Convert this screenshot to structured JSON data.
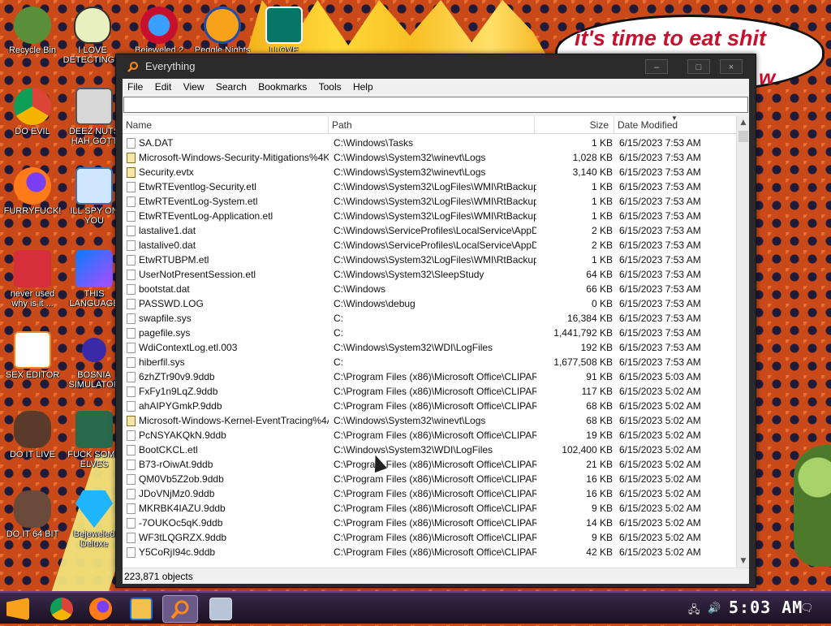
{
  "desktop": {
    "speech": {
      "line1": "it's time to eat shit",
      "line2": "w"
    },
    "icons": [
      {
        "label": "Recycle Bin"
      },
      {
        "label": "I LOVE DETECTING..."
      },
      {
        "label": "Bejeweled 2"
      },
      {
        "label": "Peggle Nights"
      },
      {
        "label": "I LOVE"
      },
      {
        "label": "DO EVIL"
      },
      {
        "label": "DEEZ NUTS HAH GOTT"
      },
      {
        "label": "FURRYFUCK!"
      },
      {
        "label": "ILL SPY ON YOU"
      },
      {
        "label": "never used why is it ..."
      },
      {
        "label": "THIS LANGUAGE"
      },
      {
        "label": "SEX EDITOR"
      },
      {
        "label": "BOSNIA SIMULATOR"
      },
      {
        "label": "DO IT LIVE"
      },
      {
        "label": "FUCK SOME ELVES"
      },
      {
        "label": "DO IT 64 BIT"
      },
      {
        "label": "Bejeweled Deluxe"
      }
    ]
  },
  "window": {
    "title": "Everything",
    "controls": {
      "minimize": "–",
      "maximize": "□",
      "close": "×"
    },
    "menu": [
      "File",
      "Edit",
      "View",
      "Search",
      "Bookmarks",
      "Tools",
      "Help"
    ],
    "search": {
      "value": "",
      "placeholder": ""
    },
    "columns": {
      "name": "Name",
      "path": "Path",
      "size": "Size",
      "date": "Date Modified"
    },
    "rows": [
      {
        "name": "SA.DAT",
        "path": "C:\\Windows\\Tasks",
        "size": "1 KB",
        "date": "6/15/2023 7:53 AM",
        "icon": "file"
      },
      {
        "name": "Microsoft-Windows-Security-Mitigations%4Kern...",
        "path": "C:\\Windows\\System32\\winevt\\Logs",
        "size": "1,028 KB",
        "date": "6/15/2023 7:53 AM",
        "icon": "event-log"
      },
      {
        "name": "Security.evtx",
        "path": "C:\\Windows\\System32\\winevt\\Logs",
        "size": "3,140 KB",
        "date": "6/15/2023 7:53 AM",
        "icon": "event-log"
      },
      {
        "name": "EtwRTEventlog-Security.etl",
        "path": "C:\\Windows\\System32\\LogFiles\\WMI\\RtBackup",
        "size": "1 KB",
        "date": "6/15/2023 7:53 AM",
        "icon": "file"
      },
      {
        "name": "EtwRTEventLog-System.etl",
        "path": "C:\\Windows\\System32\\LogFiles\\WMI\\RtBackup",
        "size": "1 KB",
        "date": "6/15/2023 7:53 AM",
        "icon": "file"
      },
      {
        "name": "EtwRTEventLog-Application.etl",
        "path": "C:\\Windows\\System32\\LogFiles\\WMI\\RtBackup",
        "size": "1 KB",
        "date": "6/15/2023 7:53 AM",
        "icon": "file"
      },
      {
        "name": "lastalive1.dat",
        "path": "C:\\Windows\\ServiceProfiles\\LocalService\\AppDat...",
        "size": "2 KB",
        "date": "6/15/2023 7:53 AM",
        "icon": "file"
      },
      {
        "name": "lastalive0.dat",
        "path": "C:\\Windows\\ServiceProfiles\\LocalService\\AppDat...",
        "size": "2 KB",
        "date": "6/15/2023 7:53 AM",
        "icon": "file"
      },
      {
        "name": "EtwRTUBPM.etl",
        "path": "C:\\Windows\\System32\\LogFiles\\WMI\\RtBackup",
        "size": "1 KB",
        "date": "6/15/2023 7:53 AM",
        "icon": "file"
      },
      {
        "name": "UserNotPresentSession.etl",
        "path": "C:\\Windows\\System32\\SleepStudy",
        "size": "64 KB",
        "date": "6/15/2023 7:53 AM",
        "icon": "file"
      },
      {
        "name": "bootstat.dat",
        "path": "C:\\Windows",
        "size": "66 KB",
        "date": "6/15/2023 7:53 AM",
        "icon": "file"
      },
      {
        "name": "PASSWD.LOG",
        "path": "C:\\Windows\\debug",
        "size": "0 KB",
        "date": "6/15/2023 7:53 AM",
        "icon": "file"
      },
      {
        "name": "swapfile.sys",
        "path": "C:",
        "size": "16,384 KB",
        "date": "6/15/2023 7:53 AM",
        "icon": "file"
      },
      {
        "name": "pagefile.sys",
        "path": "C:",
        "size": "1,441,792 KB",
        "date": "6/15/2023 7:53 AM",
        "icon": "file"
      },
      {
        "name": "WdiContextLog.etl.003",
        "path": "C:\\Windows\\System32\\WDI\\LogFiles",
        "size": "192 KB",
        "date": "6/15/2023 7:53 AM",
        "icon": "file"
      },
      {
        "name": "hiberfil.sys",
        "path": "C:",
        "size": "1,677,508 KB",
        "date": "6/15/2023 7:53 AM",
        "icon": "file"
      },
      {
        "name": "6zhZTr90v9.9ddb",
        "path": "C:\\Program Files (x86)\\Microsoft Office\\CLIPART\\...",
        "size": "91 KB",
        "date": "6/15/2023 5:03 AM",
        "icon": "file"
      },
      {
        "name": "FxFy1n9LqZ.9ddb",
        "path": "C:\\Program Files (x86)\\Microsoft Office\\CLIPART\\...",
        "size": "117 KB",
        "date": "6/15/2023 5:02 AM",
        "icon": "file"
      },
      {
        "name": "ahAIPYGmkP.9ddb",
        "path": "C:\\Program Files (x86)\\Microsoft Office\\CLIPART\\...",
        "size": "68 KB",
        "date": "6/15/2023 5:02 AM",
        "icon": "file"
      },
      {
        "name": "Microsoft-Windows-Kernel-EventTracing%4Ad...",
        "path": "C:\\Windows\\System32\\winevt\\Logs",
        "size": "68 KB",
        "date": "6/15/2023 5:02 AM",
        "icon": "event-log"
      },
      {
        "name": "PcNSYAKQkN.9ddb",
        "path": "C:\\Program Files (x86)\\Microsoft Office\\CLIPART\\...",
        "size": "19 KB",
        "date": "6/15/2023 5:02 AM",
        "icon": "file"
      },
      {
        "name": "BootCKCL.etl",
        "path": "C:\\Windows\\System32\\WDI\\LogFiles",
        "size": "102,400 KB",
        "date": "6/15/2023 5:02 AM",
        "icon": "file"
      },
      {
        "name": "B73-rOiwAt.9ddb",
        "path": "C:\\Program Files (x86)\\Microsoft Office\\CLIPART\\...",
        "size": "21 KB",
        "date": "6/15/2023 5:02 AM",
        "icon": "file"
      },
      {
        "name": "QM0Vb5Z2ob.9ddb",
        "path": "C:\\Program Files (x86)\\Microsoft Office\\CLIPART\\...",
        "size": "16 KB",
        "date": "6/15/2023 5:02 AM",
        "icon": "file"
      },
      {
        "name": "JDoVNjMz0.9ddb",
        "path": "C:\\Program Files (x86)\\Microsoft Office\\CLIPART\\...",
        "size": "16 KB",
        "date": "6/15/2023 5:02 AM",
        "icon": "file"
      },
      {
        "name": "MKRBK4IAZU.9ddb",
        "path": "C:\\Program Files (x86)\\Microsoft Office\\CLIPART\\...",
        "size": "9 KB",
        "date": "6/15/2023 5:02 AM",
        "icon": "file"
      },
      {
        "name": "-7OUKOc5qK.9ddb",
        "path": "C:\\Program Files (x86)\\Microsoft Office\\CLIPART\\...",
        "size": "14 KB",
        "date": "6/15/2023 5:02 AM",
        "icon": "file"
      },
      {
        "name": "WF3tLQGRZX.9ddb",
        "path": "C:\\Program Files (x86)\\Microsoft Office\\CLIPART\\...",
        "size": "9 KB",
        "date": "6/15/2023 5:02 AM",
        "icon": "file"
      },
      {
        "name": "Y5CoRjI94c.9ddb",
        "path": "C:\\Program Files (x86)\\Microsoft Office\\CLIPART\\...",
        "size": "42 KB",
        "date": "6/15/2023 5:02 AM",
        "icon": "file"
      }
    ],
    "status": "223,871 objects"
  },
  "taskbar": {
    "clock": "5:03 AM",
    "items": [
      "start-icon",
      "chrome-icon",
      "firefox-icon",
      "file-explorer-icon",
      "everything-icon",
      "task-manager-icon"
    ]
  },
  "colors": {
    "window_frame": "#2b2b2b",
    "speech_text": "#c8102e",
    "taskbar": "#1a1022"
  }
}
